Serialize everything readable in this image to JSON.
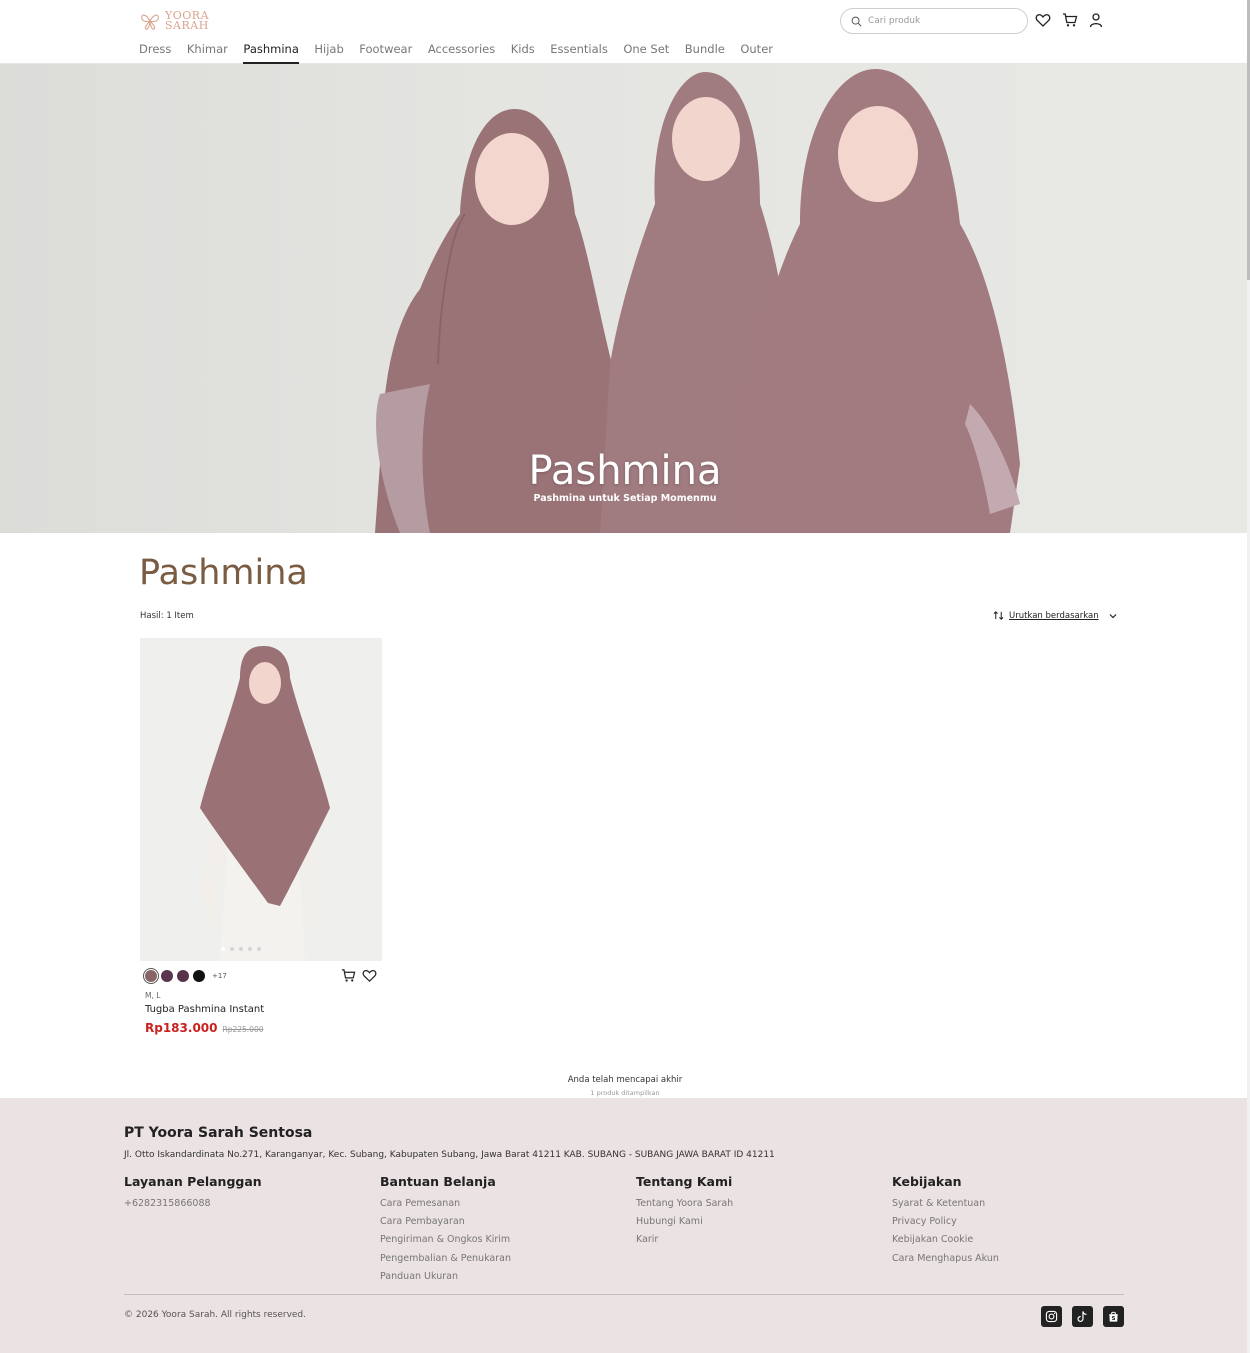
{
  "brand": {
    "line1": "YOORA",
    "line2": "SARAH"
  },
  "search": {
    "placeholder": "Cari produk"
  },
  "nav": {
    "items": [
      "Dress",
      "Khimar",
      "Pashmina",
      "Hijab",
      "Footwear",
      "Accessories",
      "Kids",
      "Essentials",
      "One Set",
      "Bundle",
      "Outer"
    ],
    "active": "Pashmina"
  },
  "hero": {
    "title": "Pashmina",
    "subtitle": "Pashmina untuk Setiap Momenmu"
  },
  "listing": {
    "title": "Pashmina",
    "result_count": "Hasil: 1 Item",
    "sort_label": "Urutkan berdasarkan"
  },
  "product": {
    "name": "Tugba Pashmina Instant",
    "sizes": "M, L",
    "price": "Rp183.000",
    "original_price": "Rp225.000",
    "more_colors": "+17",
    "swatches": [
      "#8a6566",
      "#5a3550",
      "#56334a",
      "#111111"
    ]
  },
  "end_of_list": {
    "message": "Anda telah mencapai akhir",
    "sub": "1 produk ditampilkan"
  },
  "footer": {
    "company": "PT Yoora Sarah Sentosa",
    "address": "Jl. Otto Iskandardinata No.271, Karanganyar, Kec. Subang, Kabupaten Subang, Jawa Barat 41211 KAB. SUBANG - SUBANG JAWA BARAT ID 41211",
    "columns": [
      {
        "title": "Layanan Pelanggan",
        "links": [
          "+6282315866088"
        ]
      },
      {
        "title": "Bantuan Belanja",
        "links": [
          "Cara Pemesanan",
          "Cara Pembayaran",
          "Pengiriman & Ongkos Kirim",
          "Pengembalian & Penukaran",
          "Panduan Ukuran"
        ]
      },
      {
        "title": "Tentang Kami",
        "links": [
          "Tentang Yoora Sarah",
          "Hubungi Kami",
          "Karir"
        ]
      },
      {
        "title": "Kebijakan",
        "links": [
          "Syarat & Ketentuan",
          "Privacy Policy",
          "Kebijakan Cookie",
          "Cara Menghapus Akun"
        ]
      }
    ],
    "copyright": "© 2026 Yoora Sarah. All rights reserved."
  },
  "icons": [
    "search-icon",
    "heart-icon",
    "cart-icon",
    "user-icon",
    "sort-icon",
    "chevron-down-icon",
    "instagram-icon",
    "tiktok-icon",
    "shop-bag-icon"
  ]
}
